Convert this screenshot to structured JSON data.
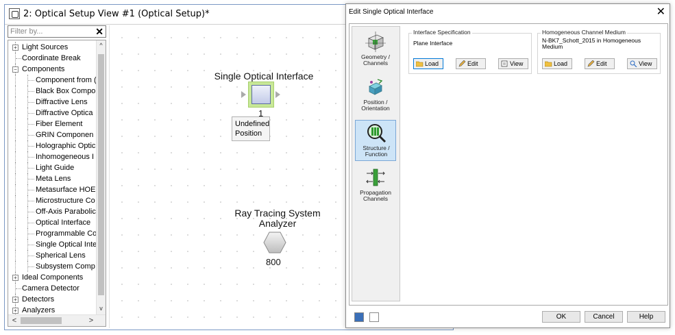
{
  "window": {
    "title": "2: Optical Setup View #1 (Optical Setup)*"
  },
  "filter": {
    "placeholder": "Filter by...",
    "clear_glyph": "✕"
  },
  "tree": {
    "items": [
      {
        "label": "Light Sources",
        "level": 0,
        "expander": "+"
      },
      {
        "label": "Coordinate Break",
        "level": 0,
        "expander": ""
      },
      {
        "label": "Components",
        "level": 0,
        "expander": "−"
      },
      {
        "label": "Component from (",
        "level": 1
      },
      {
        "label": "Black Box Compo",
        "level": 1
      },
      {
        "label": "Diffractive Lens",
        "level": 1
      },
      {
        "label": "Diffractive Optica",
        "level": 1
      },
      {
        "label": "Fiber Element",
        "level": 1
      },
      {
        "label": "GRIN Componen",
        "level": 1
      },
      {
        "label": "Holographic Optic",
        "level": 1
      },
      {
        "label": "Inhomogeneous I",
        "level": 1
      },
      {
        "label": "Light Guide",
        "level": 1
      },
      {
        "label": "Meta Lens",
        "level": 1
      },
      {
        "label": "Metasurface HOE",
        "level": 1
      },
      {
        "label": "Microstructure Co",
        "level": 1
      },
      {
        "label": "Off-Axis Parabolic",
        "level": 1
      },
      {
        "label": "Optical Interface",
        "level": 1
      },
      {
        "label": "Programmable Co",
        "level": 1
      },
      {
        "label": "Single Optical Inte",
        "level": 1
      },
      {
        "label": "Spherical Lens",
        "level": 1
      },
      {
        "label": "Subsystem Comp",
        "level": 1
      },
      {
        "label": "Ideal Components",
        "level": 0,
        "expander": "+"
      },
      {
        "label": "Camera Detector",
        "level": 0,
        "expander": ""
      },
      {
        "label": "Detectors",
        "level": 0,
        "expander": "+"
      },
      {
        "label": "Analyzers",
        "level": 0,
        "expander": "+"
      }
    ],
    "scroll_up": "^",
    "scroll_down": "v",
    "scroll_left": "<",
    "scroll_right": ">"
  },
  "canvas": {
    "soi": {
      "title": "Single Optical Interface",
      "index": "1",
      "position_line1": "Undefined",
      "position_line2": "Position"
    },
    "analyzer": {
      "title_line1": "Ray Tracing System",
      "title_line2": "Analyzer",
      "index": "800"
    }
  },
  "dialog": {
    "title": "Edit Single Optical Interface",
    "close_glyph": "✕",
    "sidebar": [
      {
        "line1": "Geometry /",
        "line2": "Channels",
        "icon": "geometry-cube-icon",
        "selected": false
      },
      {
        "line1": "Position /",
        "line2": "Orientation",
        "icon": "position-orientation-icon",
        "selected": false
      },
      {
        "line1": "Structure /",
        "line2": "Function",
        "icon": "structure-magnifier-icon",
        "selected": true
      },
      {
        "line1": "Propagation",
        "line2": "Channels",
        "icon": "propagation-channels-icon",
        "selected": false
      }
    ],
    "interface_spec": {
      "title": "Interface Specification",
      "value": "Plane Interface",
      "load": "Load",
      "edit": "Edit",
      "view": "View"
    },
    "medium": {
      "title": "Homogeneous Channel Medium",
      "value": "N-BK7_Schott_2015 in Homogeneous Medium",
      "load": "Load",
      "edit": "Edit",
      "view": "View"
    },
    "footer": {
      "ok": "OK",
      "cancel": "Cancel",
      "help": "Help"
    }
  },
  "colors": {
    "selection_blue": "#cde4f7",
    "soi_highlight_green": "#c8e898",
    "window_border": "#7a98c4"
  }
}
